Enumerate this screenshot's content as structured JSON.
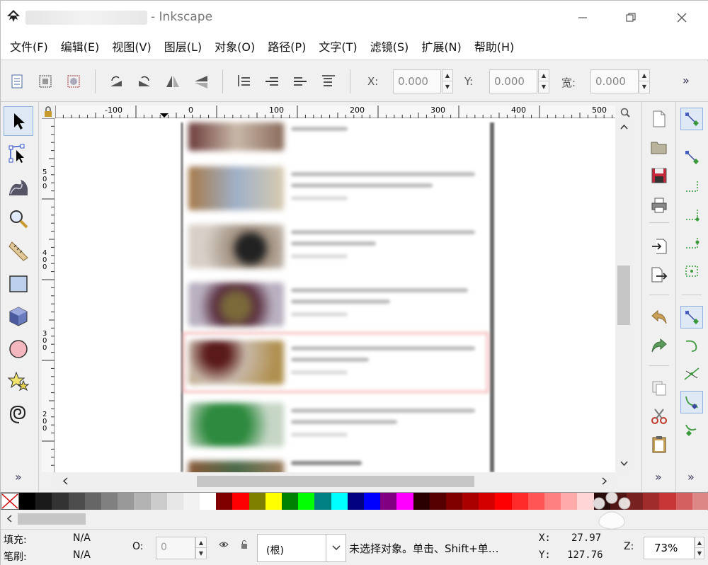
{
  "window": {
    "title": "- Inkscape"
  },
  "menu": [
    "文件(F)",
    "编辑(E)",
    "视图(V)",
    "图层(L)",
    "对象(O)",
    "路径(P)",
    "文字(T)",
    "滤镜(S)",
    "扩展(N)",
    "帮助(H)"
  ],
  "toolbar": {
    "x_label": "X:",
    "x_value": "0.000",
    "y_label": "Y:",
    "y_value": "0.000",
    "w_label": "宽:",
    "w_value": "0.000",
    "more": "»"
  },
  "ruler": {
    "top_ticks": [
      "-100",
      "0",
      "100",
      "200",
      "300",
      "400",
      "500"
    ],
    "left_ticks": [
      "500",
      "400",
      "300",
      "200"
    ]
  },
  "toolbox": {
    "more": "»"
  },
  "commands": {
    "more": "»"
  },
  "snap": {
    "more": "»"
  },
  "palette": {
    "colors": [
      "#000000",
      "#1a1a1a",
      "#333333",
      "#4d4d4d",
      "#666666",
      "#808080",
      "#999999",
      "#b3b3b3",
      "#cccccc",
      "#e6e6e6",
      "#f2f2f2",
      "#ffffff",
      "#800000",
      "#ff0000",
      "#808000",
      "#ffff00",
      "#008000",
      "#00ff00",
      "#008080",
      "#00ffff",
      "#000080",
      "#0000ff",
      "#800080",
      "#ff00ff",
      "#2b0000",
      "#550000",
      "#800000",
      "#aa0000",
      "#d40000",
      "#ff0000",
      "#ff2a2a",
      "#ff5555",
      "#ff8080",
      "#ffaaaa",
      "#ffd5d5",
      "#280b0b",
      "#501616",
      "#782121",
      "#a02c2c",
      "#c83737",
      "#d35f5f",
      "#de8787"
    ]
  },
  "status": {
    "fill_label": "填充:",
    "fill_value": "N/A",
    "stroke_label": "笔刷:",
    "stroke_value": "N/A",
    "opacity_label": "O:",
    "opacity_value": "0",
    "layer": "(根)",
    "message": "未选择对象。单击、Shift+单…",
    "x_label": "X:",
    "x_value": "27.97",
    "y_label": "Y:",
    "y_value": "127.76",
    "zoom_label": "Z:",
    "zoom_value": "73%"
  }
}
